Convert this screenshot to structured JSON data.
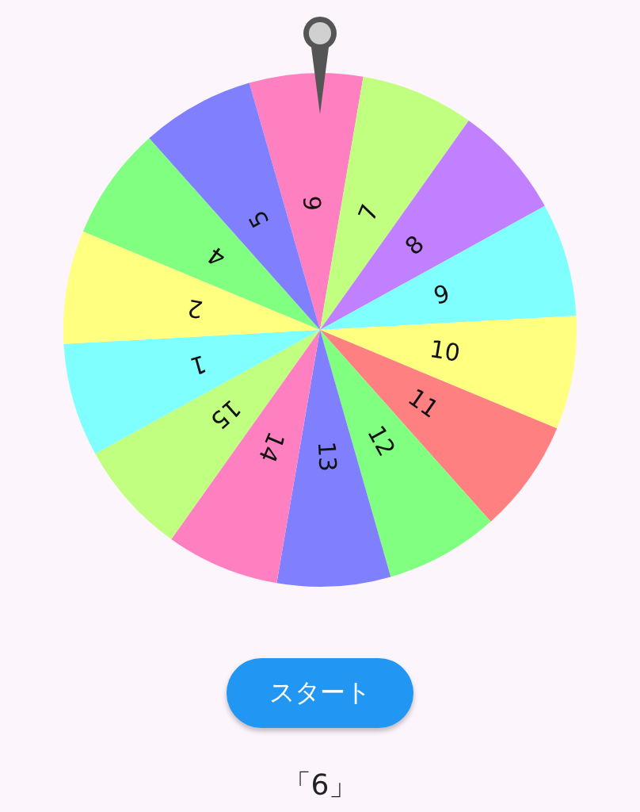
{
  "wheel": {
    "segments": [
      {
        "label": "6",
        "color": "#ff80c0"
      },
      {
        "label": "7",
        "color": "#c0ff80"
      },
      {
        "label": "8",
        "color": "#c080ff"
      },
      {
        "label": "9",
        "color": "#80ffff"
      },
      {
        "label": "10",
        "color": "#ffff80"
      },
      {
        "label": "11",
        "color": "#ff8080"
      },
      {
        "label": "12",
        "color": "#80ff80"
      },
      {
        "label": "13",
        "color": "#8080ff"
      },
      {
        "label": "14",
        "color": "#ff80c0"
      },
      {
        "label": "15",
        "color": "#c0ff80"
      },
      {
        "label": "1",
        "color": "#80ffff"
      },
      {
        "label": "2",
        "color": "#ffff80"
      },
      {
        "label": "4",
        "color": "#80ff80"
      },
      {
        "label": "5",
        "color": "#8080ff"
      }
    ]
  },
  "start_button": {
    "label": "スタート"
  },
  "result": "「6」"
}
